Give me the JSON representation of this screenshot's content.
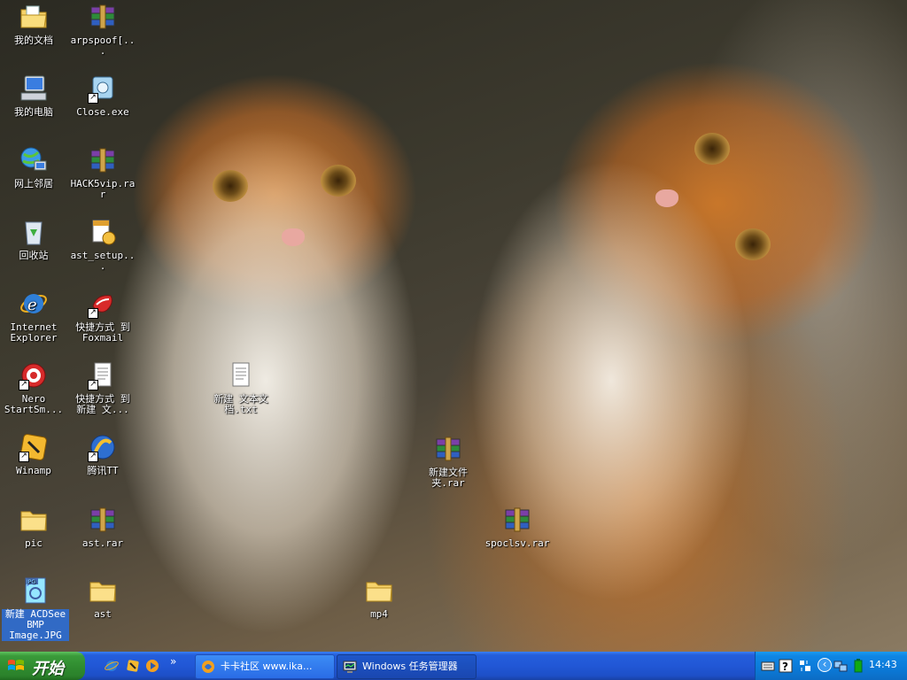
{
  "desktop": {
    "icons": [
      {
        "label": "我的文档"
      },
      {
        "label": "arpspoof[..."
      },
      {
        "label": "我的电脑"
      },
      {
        "label": "Close.exe"
      },
      {
        "label": "网上邻居"
      },
      {
        "label": "HACK5vip.rar"
      },
      {
        "label": "回收站"
      },
      {
        "label": "ast_setup..."
      },
      {
        "label": "Internet Explorer"
      },
      {
        "label": "快捷方式 到 Foxmail"
      },
      {
        "label": "Nero StartSm..."
      },
      {
        "label": "快捷方式 到 新建 文..."
      },
      {
        "label": "Winamp"
      },
      {
        "label": "腾讯TT"
      },
      {
        "label": "pic"
      },
      {
        "label": "ast.rar"
      },
      {
        "label": "新建 ACDSee BMP Image.JPG"
      },
      {
        "label": "ast"
      },
      {
        "label": "新建 文本文档.txt"
      },
      {
        "label": "新建文件夹.rar"
      },
      {
        "label": "spoclsv.rar"
      },
      {
        "label": "mp4"
      }
    ]
  },
  "taskbar": {
    "start_label": "开始",
    "quick_launch_more": "»",
    "buttons": [
      {
        "label": "卡卡社区 www.ika..."
      },
      {
        "label": "Windows 任务管理器"
      }
    ],
    "tray": {
      "chevron": "‹",
      "clock": "14:43"
    }
  }
}
